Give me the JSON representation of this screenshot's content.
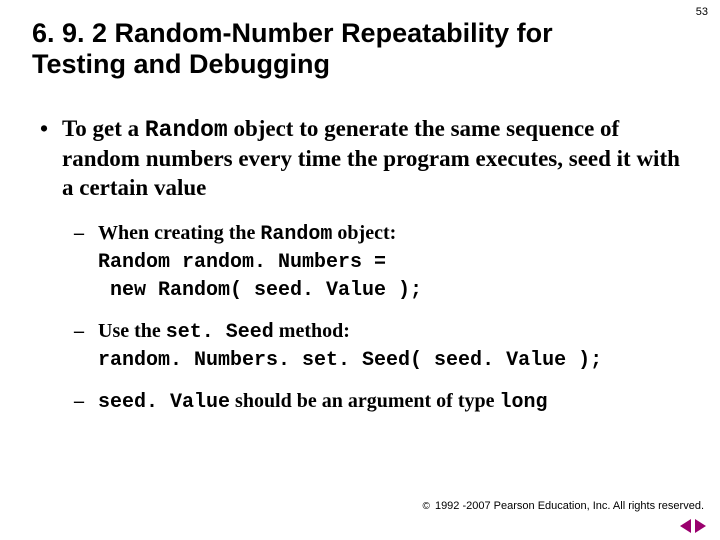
{
  "pageNumber": "53",
  "title": "6. 9. 2 Random-Number Repeatability for Testing and Debugging",
  "bullet1": {
    "marker": "•",
    "pre": "To get a ",
    "code": "Random",
    "post": " object to generate the same sequence of random numbers every time the program executes, seed it with a certain value"
  },
  "sub1": {
    "dash": "–",
    "pre": "When creating the ",
    "code": "Random",
    "post": " object:",
    "codeLine1": "Random random. Numbers =",
    "codeLine2": " new Random( seed. Value );"
  },
  "sub2": {
    "dash": "–",
    "pre": "Use the ",
    "code": "set. Seed",
    "post": " method:",
    "codeLine": "random. Numbers. set. Seed( seed. Value );"
  },
  "sub3": {
    "dash": "–",
    "code1": "seed. Value",
    "mid": " should be an argument of type ",
    "code2": "long"
  },
  "footer": {
    "copyrightSymbol": "©",
    "text": " 1992 -2007 Pearson Education, Inc.  All rights reserved."
  }
}
